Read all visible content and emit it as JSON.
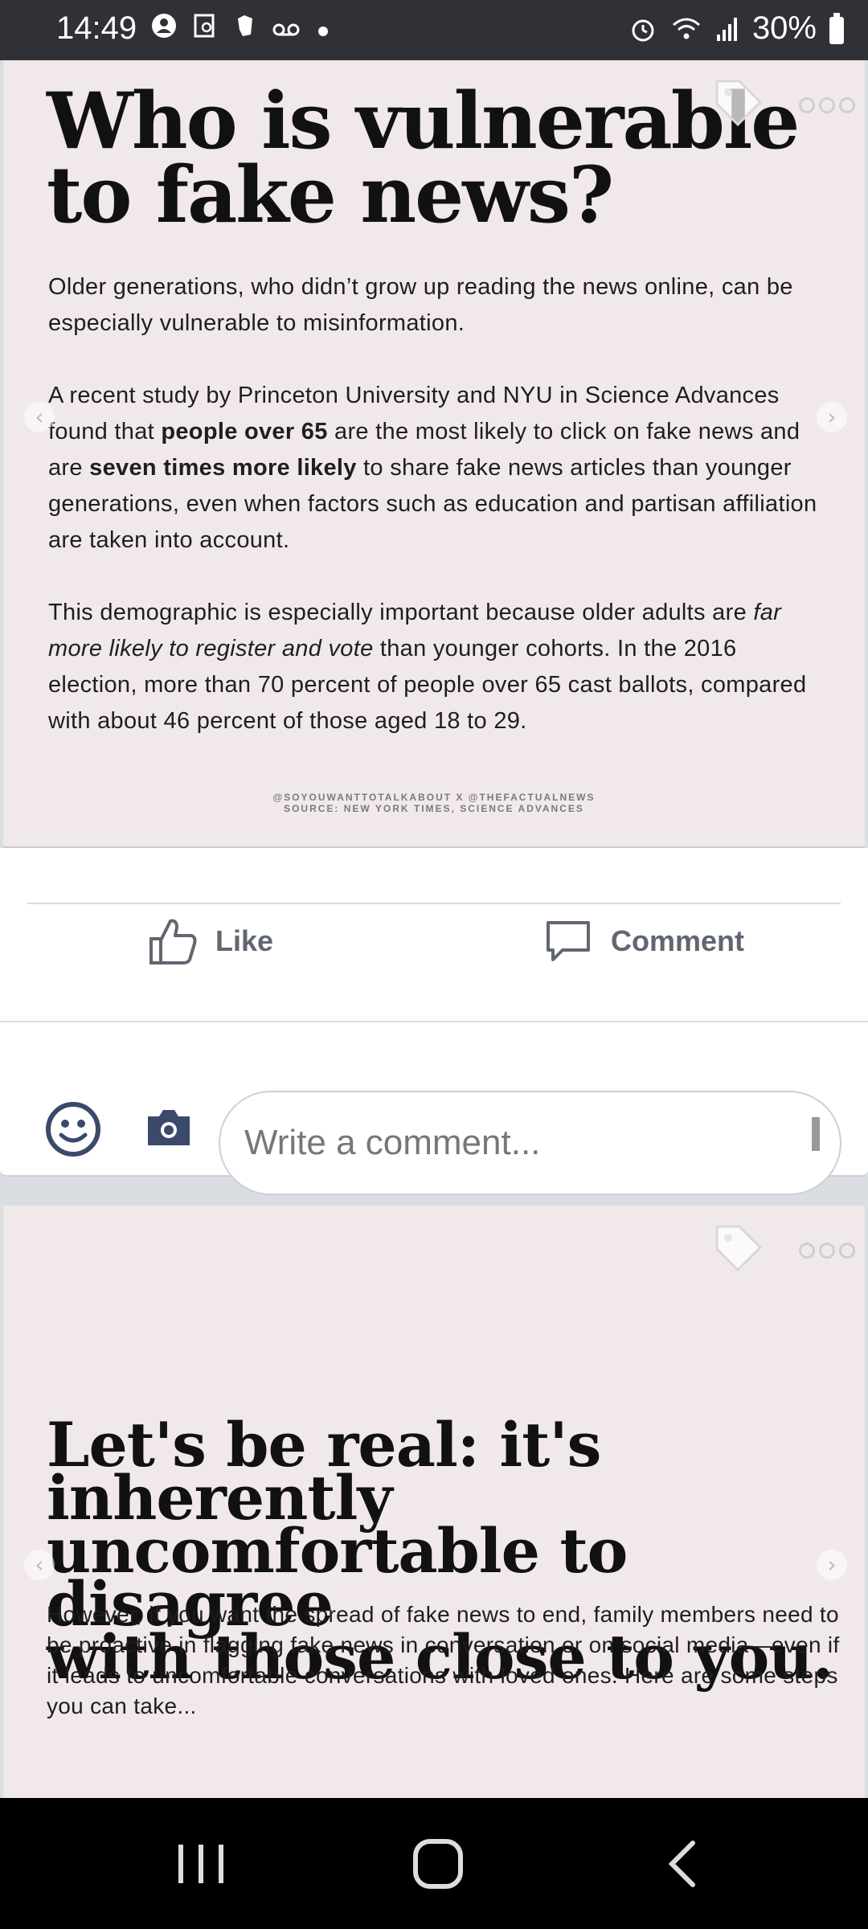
{
  "status_bar": {
    "time": "14:49",
    "battery": "30%",
    "left_icons": [
      "account-icon",
      "screenshot-icon",
      "evernote-icon",
      "voicemail-icon",
      "notification-dot-icon"
    ],
    "right_icons": [
      "alarm-icon",
      "wifi-icon",
      "signal-icon",
      "battery-icon"
    ]
  },
  "post1": {
    "headline_line1": "Who is vulnerable",
    "headline_line2": "to fake news?",
    "para1": "Older generations, who didn’t grow up reading the news online, can be especially vulnerable to misinformation.",
    "para2_part1": "A recent study by Princeton University and NYU in Science Advances found that ",
    "para2_bold1": "people over 65",
    "para2_part2": " are the most likely to click on fake news and are ",
    "para2_bold2": "seven times more likely",
    "para2_part3": " to share fake news articles than younger generations, even when factors such as education and partisan affiliation are taken into account.",
    "para3_part1": "This demographic is especially important because older adults are ",
    "para3_italic": "far more likely to register and vote",
    "para3_part2": " than younger cohorts. In the 2016 election, more than 70 percent of people over 65 cast ballots, compared with about 46 percent of those aged 18 to 29.",
    "credit_line1": "@SOYOUWANTTOTALKABOUT X @THEFACTUALNEWS",
    "credit_line2": "SOURCE: NEW YORK TIMES, SCIENCE ADVANCES"
  },
  "actions": {
    "like_label": "Like",
    "comment_label": "Comment",
    "comment_placeholder": "Write a comment..."
  },
  "post2": {
    "headline_line1": "Let's be real: it's inherently",
    "headline_line2": "uncomfortable to disagree",
    "headline_line3": "with those close to you.",
    "para1": "However, if you want the spread of fake news to end, family members need to be proactive in flagging fake news in conversation or on social media—even if it leads to uncomfortable conversations with loved ones. Here are some steps you can take..."
  },
  "colors": {
    "status_bar_bg": "#303136",
    "card_bg": "#f1e9e9",
    "action_text": "#606770",
    "icon_navy": "#3b4a6b"
  }
}
